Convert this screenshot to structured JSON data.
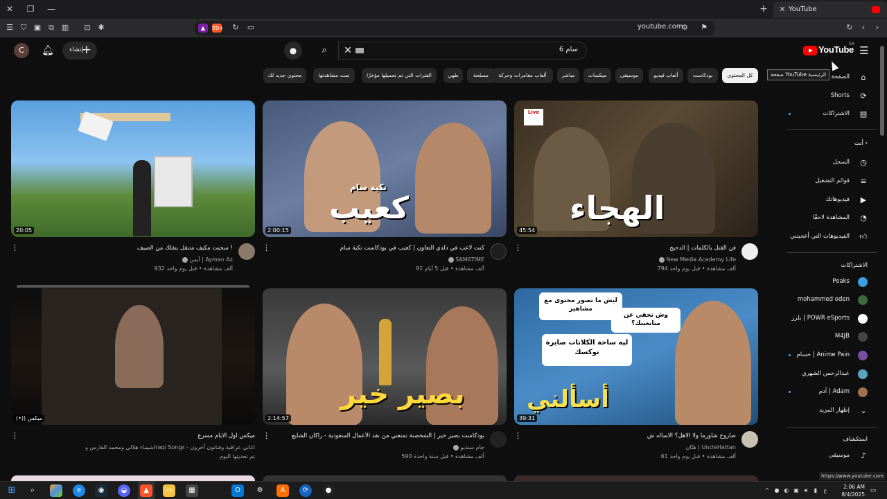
{
  "browser": {
    "tab_title": "YouTube",
    "url": "youtube.com",
    "status_url": "https://www.youtube.com",
    "ext_badge": "99+"
  },
  "masthead": {
    "avatar_letter": "C",
    "create_label": "إنشاء",
    "search_query": "سام 6",
    "logo_text": "YouTube",
    "region": "SA"
  },
  "tooltip": "صفحة YouTube الرئيسية",
  "chips": [
    "كل المحتوى",
    "بودكاست",
    "ألعاب فيديو",
    "موسيقى",
    "ميكسات",
    "مباشر",
    "ألعاب مغامرات وحركة",
    "مسلحة",
    "طهي",
    "الفترات التي تم تحميلها مؤخرًا",
    "تمت مشاهدتها",
    "محتوى جديد لك"
  ],
  "videos": [
    {
      "title": "فن القتل بالكلمات | الدحيح",
      "channel": "New Media Academy Life",
      "meta": "794 ألف مشاهدة • قبل يوم واحد",
      "duration": "45:54",
      "thumb_text": "الهجاء",
      "badge": "Live"
    },
    {
      "title": "كنت لاعب في دلدي التعاون | كعيب في بودكاست تكية سام",
      "channel": "SAM6TIME",
      "meta": "91 ألف مشاهدة • قبل 5 أيام",
      "duration": "2:00:15",
      "thumb_text": "كعيب",
      "thumb_sub": "تكية سام"
    },
    {
      "title": "سحبت مكيف متنقل يتقلك من الصيف !",
      "channel": "أيمن | Ayman Az",
      "meta": "932 ألف مشاهدة • قبل يوم واحد",
      "duration": "20:05"
    },
    {
      "title": "صاروخ شاورما ولا الاهل؟ الاسأله ش",
      "channel": "هتّان | UncleHattan",
      "meta": "61 ألف مشاهدة • قبل يوم واحد",
      "duration": "39:31",
      "thumb_text": "أسألني",
      "bubbles": [
        "ليش ما تصور محتوى مع مشاهير",
        "وش تخفي عن متابعينك؟",
        "ليه ساحة الكلانات صايرة توكسك"
      ]
    },
    {
      "title": "بودكاست بصير خير | الشخصنة تمنعني من نقد الأعمال السعودية - راكان الشايع",
      "channel": "جام ستديو",
      "meta": "590 ألف مشاهدة • قبل سنة واحدة",
      "duration": "2:14:57",
      "thumb_text": "بصير خير"
    },
    {
      "title": "ميكس اول الايام مسرع",
      "channel": "شيماء هلالي ومحمد الفارس وIraqi Songs - اغاني عراقية وفنانون آخرون",
      "meta": "تم تحديثها اليوم",
      "duration": "(•)) ميكس"
    }
  ],
  "sidebar": {
    "main": [
      {
        "label": "الصفحة الرئيسية",
        "icon": "home-icon"
      },
      {
        "label": "Shorts",
        "icon": "shorts-icon"
      },
      {
        "label": "الاشتراكات",
        "icon": "subscriptions-icon"
      }
    ],
    "you_header": "أنت",
    "you": [
      {
        "label": "السجل",
        "icon": "history-icon"
      },
      {
        "label": "قوائم التشغيل",
        "icon": "playlists-icon"
      },
      {
        "label": "فيديوهاتك",
        "icon": "your-videos-icon"
      },
      {
        "label": "المشاهدة لاحقًا",
        "icon": "watch-later-icon"
      },
      {
        "label": "الفيديوهات التي أعجبتني",
        "icon": "liked-icon"
      }
    ],
    "subs_header": "الاشتراكات",
    "subs": [
      {
        "label": "Peaks",
        "color": "#3aa0e0"
      },
      {
        "label": "mohammed oden",
        "color": "#3d6b3d"
      },
      {
        "label": "بلرز | POWR eSports",
        "color": "#ffffff"
      },
      {
        "label": "M4JB",
        "color": "#444444"
      },
      {
        "label": "حسام | Anime Pain",
        "color": "#7a4fa0"
      },
      {
        "label": "عبدالرحمن الشهري",
        "color": "#5aa0c0"
      },
      {
        "label": "آدم | Adam",
        "color": "#a07050"
      }
    ],
    "show_more": "إظهار المزيد",
    "explore_header": "استكشاف",
    "explore": [
      {
        "label": "موسيقى",
        "icon": "music-icon"
      }
    ]
  },
  "taskbar": {
    "time": "2:06 AM",
    "date": "8/4/2025",
    "lang": "ع"
  }
}
